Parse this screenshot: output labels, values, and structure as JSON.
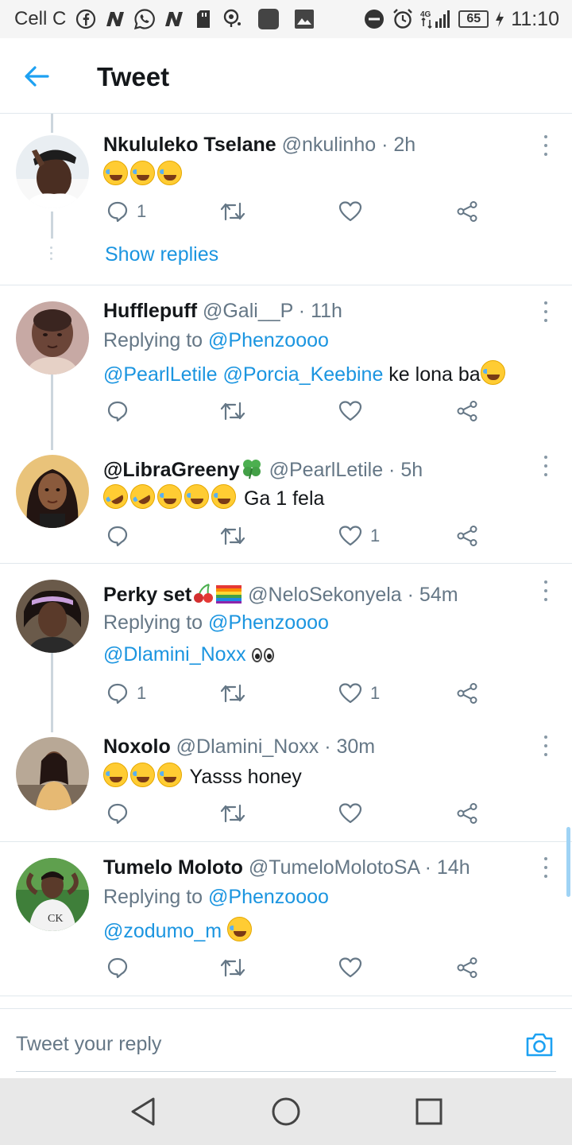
{
  "status_bar": {
    "carrier": "Cell C",
    "network": "4G",
    "battery": "65",
    "time": "11:10",
    "notification_icons": [
      "facebook-icon",
      "news-icon",
      "whatsapp-icon",
      "news-icon",
      "sd-card-icon",
      "location-icon",
      "app-icon",
      "image-icon"
    ],
    "system_icons": [
      "do-not-disturb-icon",
      "alarm-icon",
      "signal-icon",
      "battery-icon",
      "charging-icon"
    ]
  },
  "header": {
    "title": "Tweet"
  },
  "tweets": [
    {
      "name": "Nkululeko Tselane",
      "meta": "@nkulinho · 2h",
      "replying_label": "",
      "replying_to": "",
      "mentions": "",
      "text": "",
      "emoji": [
        "joy",
        "joy",
        "joy"
      ],
      "reply_count": "1",
      "like_count": "",
      "show_replies": "Show replies"
    },
    {
      "name": "Hufflepuff",
      "meta": "@Gali__P · 11h",
      "replying_label": "Replying to",
      "replying_to": "@Phenzoooo",
      "mentions": "@PearlLetile @Porcia_Keebine",
      "text": "ke lona ba",
      "emoji": [
        "joy"
      ],
      "reply_count": "",
      "like_count": ""
    },
    {
      "name": "@LibraGreeny",
      "name_emoji": "four-leaf-clover",
      "meta": "@PearlLetile · 5h",
      "emoji": [
        "rofl",
        "rofl",
        "joy",
        "joy",
        "joy"
      ],
      "text": "Ga 1 fela",
      "reply_count": "",
      "like_count": "1"
    },
    {
      "name": "Perky set",
      "name_emoji": "cherries rainbow-flag",
      "meta": "@NeloSekonyela · 54m",
      "replying_label": "Replying to",
      "replying_to": "@Phenzoooo",
      "mentions": "@Dlamini_Noxx",
      "text_emoji": "eyes",
      "reply_count": "1",
      "like_count": "1"
    },
    {
      "name": "Noxolo",
      "meta": "@Dlamini_Noxx · 30m",
      "emoji": [
        "joy",
        "joy",
        "joy"
      ],
      "text": "Yasss honey",
      "reply_count": "",
      "like_count": ""
    },
    {
      "name": "Tumelo Moloto",
      "meta": "@TumeloMolotoSA · 14h",
      "replying_label": "Replying to",
      "replying_to": "@Phenzoooo",
      "mentions": "@zodumo_m",
      "emoji": [
        "joy"
      ],
      "reply_count": "",
      "like_count": ""
    }
  ],
  "reply_bar": {
    "placeholder": "Tweet your reply"
  },
  "colors": {
    "link": "#1b95e0",
    "text": "#14171a",
    "meta": "#657786",
    "divider": "#e1e8ed"
  }
}
